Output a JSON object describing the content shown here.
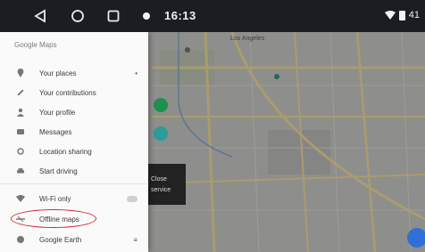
{
  "status_bar": {
    "time": "16:13",
    "nav_back_icon": "back-triangle-icon",
    "nav_home_icon": "home-circle-icon",
    "nav_recent_icon": "recent-square-icon",
    "battery_text": "41"
  },
  "drawer": {
    "title": "Google Maps",
    "items": [
      {
        "label": "Your places",
        "icon": "pin-icon",
        "trail": "•"
      },
      {
        "label": "Your contributions",
        "icon": "edit-icon",
        "trail": ""
      },
      {
        "label": "Your profile",
        "icon": "person-icon",
        "trail": ""
      },
      {
        "label": "Messages",
        "icon": "message-icon",
        "trail": ""
      },
      {
        "label": "Location sharing",
        "icon": "location-sharing-icon",
        "trail": ""
      },
      {
        "label": "Start driving",
        "icon": "car-icon",
        "trail": ""
      },
      {
        "label": "Wi-Fi only",
        "icon": "wifi-icon",
        "trail": ""
      },
      {
        "label": "Offline maps",
        "icon": "offline-icon",
        "trail": ""
      },
      {
        "label": "Google Earth",
        "icon": "earth-icon",
        "trail": "≡"
      }
    ]
  },
  "map": {
    "labels": [
      "Los Angeles"
    ],
    "thumbnail_lines": [
      "Close",
      "service"
    ]
  },
  "colors": {
    "highlight": "#d71f26",
    "fab_green": "#1f8f4f",
    "fab_blue": "#2f6fd6"
  }
}
